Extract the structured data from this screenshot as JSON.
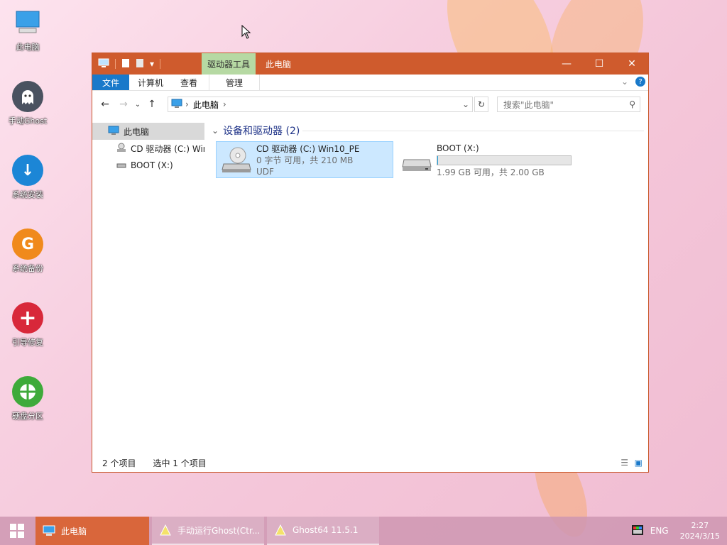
{
  "desktop": {
    "icons": [
      {
        "label": "此电脑"
      },
      {
        "label": "手动Ghost"
      },
      {
        "label": "系统安装"
      },
      {
        "label": "系统备份"
      },
      {
        "label": "引导修复"
      },
      {
        "label": "硬盘分区"
      }
    ]
  },
  "window": {
    "context_tab": "驱动器工具",
    "title": "此电脑",
    "ribbon": {
      "file": "文件",
      "computer": "计算机",
      "view": "查看",
      "manage": "管理"
    },
    "address": {
      "location": "此电脑"
    },
    "search": {
      "placeholder": "搜索\"此电脑\""
    },
    "sidebar": {
      "items": [
        {
          "label": "此电脑"
        },
        {
          "label": "CD 驱动器 (C:) Win"
        },
        {
          "label": "BOOT (X:)"
        }
      ]
    },
    "group": {
      "title": "设备和驱动器 (2)"
    },
    "drives": [
      {
        "name": "CD 驱动器 (C:) Win10_PE",
        "info": "0 字节 可用，共 210 MB",
        "fs": "UDF"
      },
      {
        "name": "BOOT (X:)",
        "info": "1.99 GB 可用，共 2.00 GB",
        "used_fraction": 0.005
      }
    ],
    "status": {
      "count": "2 个项目",
      "selected": "选中 1 个项目"
    }
  },
  "taskbar": {
    "tasks": [
      {
        "label": "此电脑"
      },
      {
        "label": "手动运行Ghost(Ctr..."
      },
      {
        "label": "Ghost64 11.5.1"
      }
    ],
    "tray": {
      "lang": "ENG",
      "time": "2:27",
      "date": "2024/3/15"
    }
  },
  "colors": {
    "titlebar": "#cf5b2d",
    "accent": "#1979ca",
    "selection": "#cce8ff"
  }
}
